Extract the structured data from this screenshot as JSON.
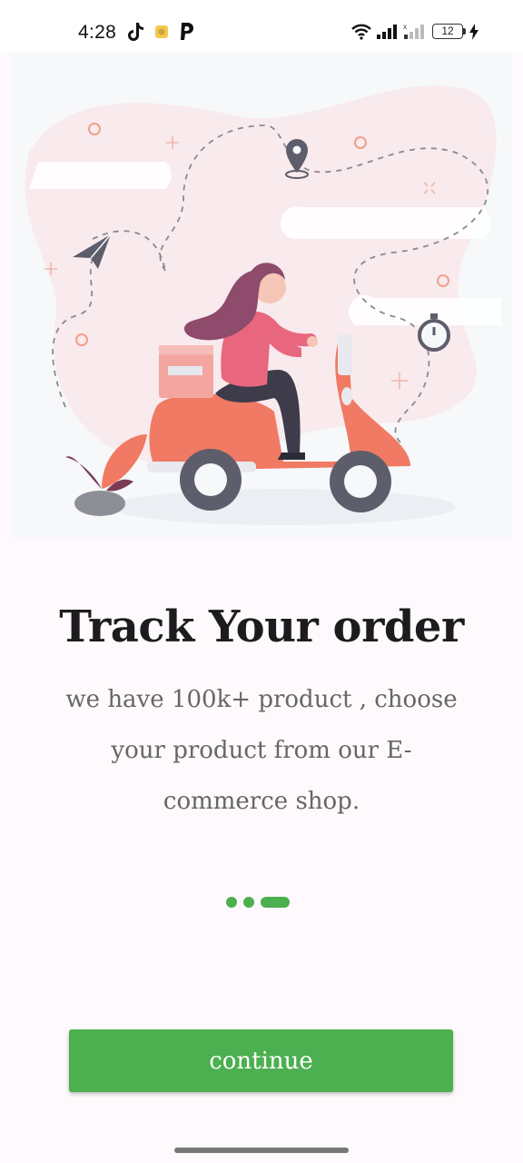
{
  "status_bar": {
    "time": "4:28",
    "battery_level": "12",
    "notification_icons": [
      "tiktok-icon",
      "app-notification-icon",
      "paypal-icon"
    ],
    "system_icons": [
      "wifi-icon",
      "signal-icon",
      "signal-no-service-icon",
      "battery-icon",
      "charging-icon"
    ]
  },
  "onboarding": {
    "illustration": "delivery-scooter-illustration",
    "title": "Track Your order",
    "subtitle": "we have 100k+ product , choose your product from our E-commerce shop.",
    "page_indicator": {
      "total": 3,
      "active_index": 2
    },
    "continue_label": "continue"
  },
  "colors": {
    "accent": "#4caf50",
    "title": "#1c1c1e",
    "subtitle": "#666666",
    "scooter": "#f07a63",
    "background": "#fdf9fc"
  }
}
